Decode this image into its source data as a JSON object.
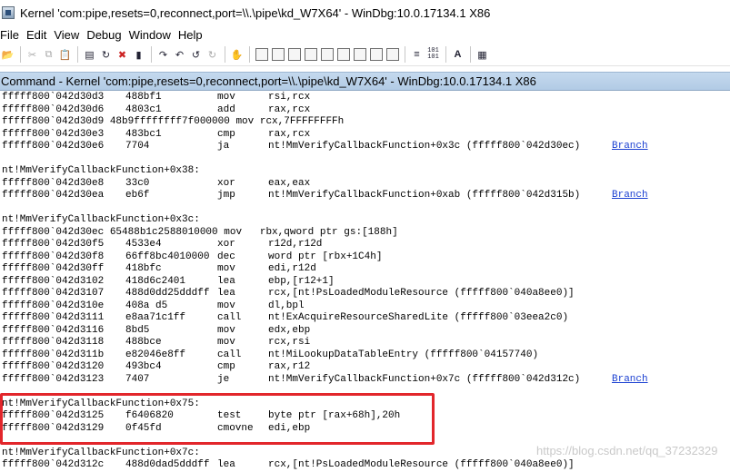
{
  "window": {
    "title": "Kernel 'com:pipe,resets=0,reconnect,port=\\\\.\\pipe\\kd_W7X64' - WinDbg:10.0.17134.1 X86"
  },
  "menu": [
    "File",
    "Edit",
    "View",
    "Debug",
    "Window",
    "Help"
  ],
  "command_window": {
    "title": "Command - Kernel 'com:pipe,resets=0,reconnect,port=\\\\.\\pipe\\kd_W7X64' - WinDbg:10.0.17134.1 X86"
  },
  "branch_label": "Branch",
  "lines": [
    {
      "addr": "fffff800`042d30d3",
      "op": "488bf1",
      "mn": "mov",
      "args": "rsi,rcx"
    },
    {
      "addr": "fffff800`042d30d6",
      "op": "4803c1",
      "mn": "add",
      "args": "rax,rcx"
    },
    {
      "raw": "fffff800`042d30d9 48b9ffffffff7f000000 mov rcx,7FFFFFFFFh"
    },
    {
      "addr": "fffff800`042d30e3",
      "op": "483bc1",
      "mn": "cmp",
      "args": "rax,rcx"
    },
    {
      "addr": "fffff800`042d30e6",
      "op": "7704",
      "mn": "ja",
      "args": "nt!MmVerifyCallbackFunction+0x3c (fffff800`042d30ec)",
      "branch": true
    },
    {
      "blank": true
    },
    {
      "label": "nt!MmVerifyCallbackFunction+0x38:"
    },
    {
      "addr": "fffff800`042d30e8",
      "op": "33c0",
      "mn": "xor",
      "args": "eax,eax"
    },
    {
      "addr": "fffff800`042d30ea",
      "op": "eb6f",
      "mn": "jmp",
      "args": "nt!MmVerifyCallbackFunction+0xab (fffff800`042d315b)",
      "branch": true
    },
    {
      "blank": true
    },
    {
      "label": "nt!MmVerifyCallbackFunction+0x3c:"
    },
    {
      "raw": "fffff800`042d30ec 65488b1c2588010000 mov   rbx,qword ptr gs:[188h]"
    },
    {
      "addr": "fffff800`042d30f5",
      "op": "4533e4",
      "mn": "xor",
      "args": "r12d,r12d"
    },
    {
      "addr": "fffff800`042d30f8",
      "op": "66ff8bc4010000",
      "mn": "dec",
      "args": "word ptr [rbx+1C4h]"
    },
    {
      "addr": "fffff800`042d30ff",
      "op": "418bfc",
      "mn": "mov",
      "args": "edi,r12d"
    },
    {
      "addr": "fffff800`042d3102",
      "op": "418d6c2401",
      "mn": "lea",
      "args": "ebp,[r12+1]"
    },
    {
      "addr": "fffff800`042d3107",
      "op": "488d0dd25dddff",
      "mn": "lea",
      "args": "rcx,[nt!PsLoadedModuleResource (fffff800`040a8ee0)]"
    },
    {
      "addr": "fffff800`042d310e",
      "op": "408a d5",
      "mn": "mov",
      "args": "dl,bpl"
    },
    {
      "addr": "fffff800`042d3111",
      "op": "e8aa71c1ff",
      "mn": "call",
      "args": "nt!ExAcquireResourceSharedLite (fffff800`03eea2c0)"
    },
    {
      "addr": "fffff800`042d3116",
      "op": "8bd5",
      "mn": "mov",
      "args": "edx,ebp"
    },
    {
      "addr": "fffff800`042d3118",
      "op": "488bce",
      "mn": "mov",
      "args": "rcx,rsi"
    },
    {
      "addr": "fffff800`042d311b",
      "op": "e82046e8ff",
      "mn": "call",
      "args": "nt!MiLookupDataTableEntry (fffff800`04157740)"
    },
    {
      "addr": "fffff800`042d3120",
      "op": "493bc4",
      "mn": "cmp",
      "args": "rax,r12"
    },
    {
      "addr": "fffff800`042d3123",
      "op": "7407",
      "mn": "je",
      "args": "nt!MmVerifyCallbackFunction+0x7c (fffff800`042d312c)",
      "branch": true
    },
    {
      "blank": true
    },
    {
      "label": "nt!MmVerifyCallbackFunction+0x75:"
    },
    {
      "addr": "fffff800`042d3125",
      "op": "f6406820",
      "mn": "test",
      "args": "byte ptr [rax+68h],20h"
    },
    {
      "addr": "fffff800`042d3129",
      "op": "0f45fd",
      "mn": "cmovne",
      "args": "edi,ebp"
    },
    {
      "blank": true
    },
    {
      "label": "nt!MmVerifyCallbackFunction+0x7c:"
    },
    {
      "addr": "fffff800`042d312c",
      "op": "488d0dad5dddff",
      "mn": "lea",
      "args": "rcx,[nt!PsLoadedModuleResource (fffff800`040a8ee0)]"
    }
  ],
  "watermark": "https://blog.csdn.net/qq_37232329"
}
